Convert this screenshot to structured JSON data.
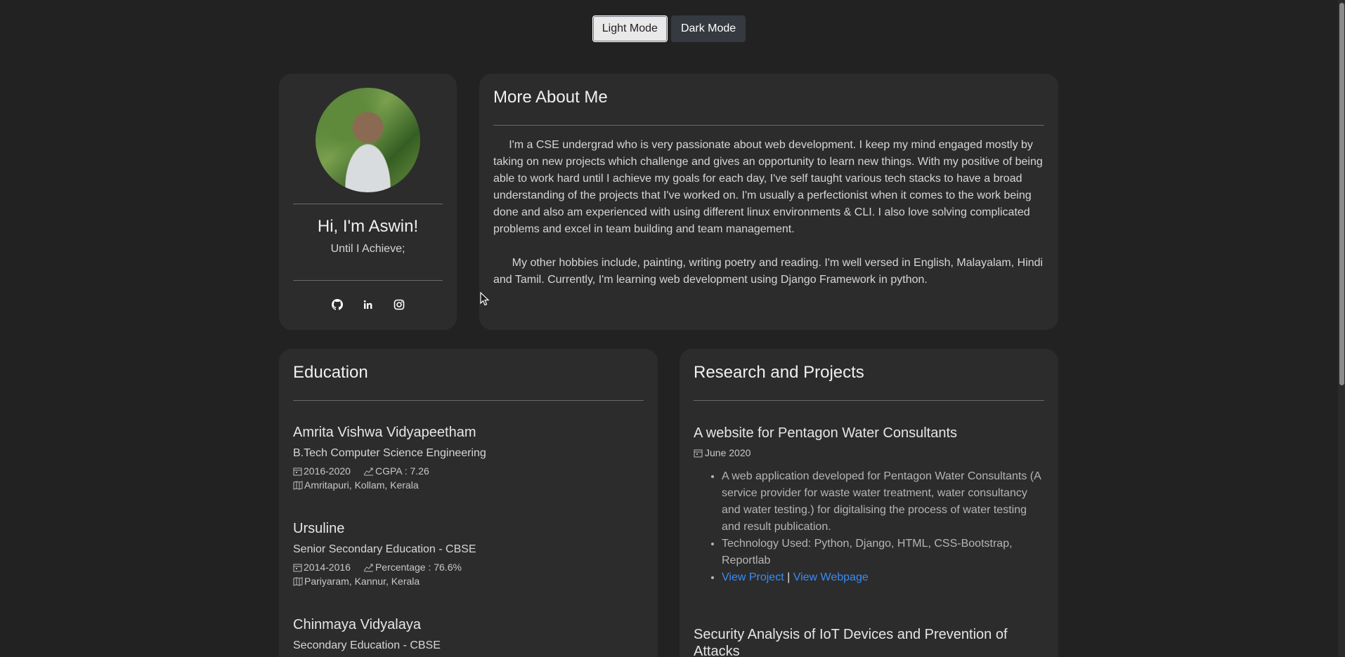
{
  "mode_buttons": {
    "light": "Light Mode",
    "dark": "Dark Mode"
  },
  "profile": {
    "name": "Hi, I'm Aswin!",
    "tagline": "Until I Achieve;",
    "socials": [
      "github-icon",
      "linkedin-icon",
      "instagram-icon"
    ]
  },
  "about": {
    "title": "More About Me",
    "para1": "     I'm a CSE undergrad who is very passionate about web development. I keep my mind engaged mostly by taking on new projects which challenge and gives an opportunity to learn new things. With my positive of being able to work hard until I achieve my goals for each day, I've self taught various tech stacks to have a broad understanding of the projects that I've worked on. I'm usually a perfectionist when it comes to the work being done and also am experienced with using different linux environments & CLI. I also love solving complicated problems and excel in team building and team management.",
    "para2": "      My other hobbies include, painting, writing poetry and reading. I'm well versed in English, Malayalam, Hindi and Tamil. Currently, I'm learning web development using Django Framework in python."
  },
  "education": {
    "title": "Education",
    "items": [
      {
        "school": "Amrita Vishwa Vidyapeetham",
        "degree": "B.Tech Computer Science Engineering",
        "years": "2016-2020",
        "score": "CGPA : 7.26",
        "location": "Amritapuri, Kollam, Kerala"
      },
      {
        "school": "Ursuline",
        "degree": "Senior Secondary Education - CBSE",
        "years": "2014-2016",
        "score": "Percentage : 76.6%",
        "location": "Pariyaram, Kannur, Kerala"
      },
      {
        "school": "Chinmaya Vidyalaya",
        "degree": "Secondary Education - CBSE"
      }
    ]
  },
  "projects": {
    "title": "Research and Projects",
    "items": [
      {
        "title": "A website for Pentagon Water Consultants",
        "date": "June 2020",
        "bullet1": "A web application developed for Pentagon Water Consultants (A service provider for waste water treatment, water consultancy and water testing.) for digitalising the process of water testing and result publication.",
        "bullet2": "Technology Used: Python, Django, HTML, CSS-Bootstrap, Reportlab",
        "link1": "View Project",
        "separator": "|",
        "link2": "View Webpage"
      },
      {
        "title": "Security Analysis of IoT Devices and Prevention of Attacks"
      }
    ]
  },
  "colors": {
    "background": "#222222",
    "card": "#2c2c2c",
    "link": "#3b8cf5"
  }
}
